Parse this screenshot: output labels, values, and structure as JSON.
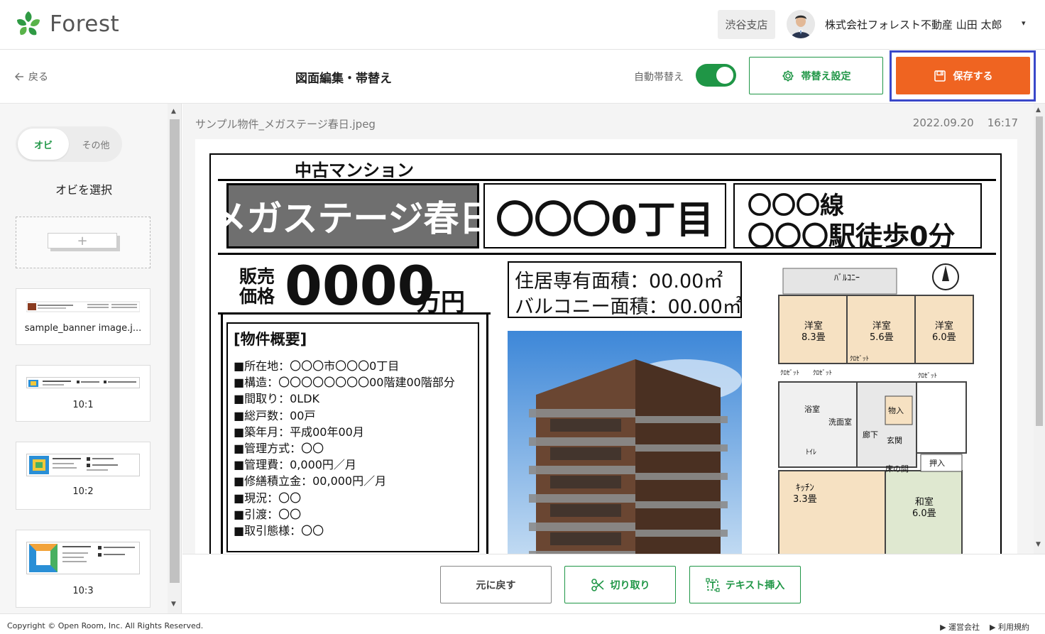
{
  "app": {
    "logo_text": "Forest",
    "branch": "渋谷支店",
    "user_name": "株式会社フォレスト不動産 山田 太郎",
    "user_caret": "▾"
  },
  "toolbar": {
    "back_label": "戻る",
    "title": "図面編集・帯替え",
    "auto_band_label": "自動帯替え",
    "auto_band_on": true,
    "band_settings_label": "帯替え設定",
    "save_label": "保存する"
  },
  "sidebar": {
    "tabs": {
      "obi": "オビ",
      "other": "その他"
    },
    "title": "オビを選択",
    "add_symbol": "+",
    "items": [
      {
        "label": "sample_banner image.j..."
      },
      {
        "label": "10:1"
      },
      {
        "label": "10:2"
      },
      {
        "label": "10:3"
      }
    ]
  },
  "main": {
    "file_name": "サンプル物件_メガステージ春日.jpeg",
    "date": "2022.09.20",
    "time": "16:17"
  },
  "flyer": {
    "category": "中古マンション",
    "property_name": "メガステージ春日",
    "address": "〇〇〇0丁目",
    "line1": "〇〇〇線",
    "line2": "〇〇〇駅徒歩0分",
    "price_label_1": "販売",
    "price_label_2": "価格",
    "price": "0000",
    "price_unit": "万円",
    "area_1": "住居専有面積：00.00㎡",
    "area_2": "バルコニー面積：00.00㎡",
    "overview_title": "[物件概要]",
    "overview": [
      "■所在地：〇〇〇市〇〇〇0丁目",
      "■構造：〇〇〇〇〇〇〇〇00階建00階部分",
      "■間取り：0LDK",
      "■総戸数：00戸",
      "■築年月：平成00年00月",
      "■管理方式：〇〇",
      "■管理費：0,000円／月",
      "■修繕積立金：00,000円／月",
      "■現況：〇〇",
      "■引渡：〇〇",
      "■取引態様：〇〇"
    ],
    "floorplan": {
      "balcony": "ﾊﾞﾙｺﾆｰ",
      "rooms": [
        {
          "name": "洋室",
          "size": "8.3畳"
        },
        {
          "name": "洋室",
          "size": "5.6畳"
        },
        {
          "name": "洋室",
          "size": "6.0畳"
        },
        {
          "name": "和室",
          "size": "6.0畳"
        },
        {
          "name": "ｷｯﾁﾝ",
          "size": "3.3畳"
        }
      ],
      "labels": [
        "ｸﾛｾﾞｯﾄ",
        "ｸﾛｾﾞｯﾄ",
        "ｸﾛｾﾞｯﾄ",
        "ｸﾛｾﾞｯﾄ",
        "浴室",
        "洗面室",
        "ﾄｲﾚ",
        "廊下",
        "玄関",
        "物入",
        "押入",
        "床の間"
      ]
    }
  },
  "bottom": {
    "undo_label": "元に戻す",
    "cut_label": "切り取り",
    "insert_label": "テキスト挿入"
  },
  "footer": {
    "copyright": "Copyright © Open Room, Inc. All Rights Reserved.",
    "link_company": "運営会社",
    "link_terms": "利用規約"
  },
  "colors": {
    "brand_green": "#1f9646",
    "save_orange": "#ef6421",
    "highlight_blue": "#3a48c9"
  }
}
